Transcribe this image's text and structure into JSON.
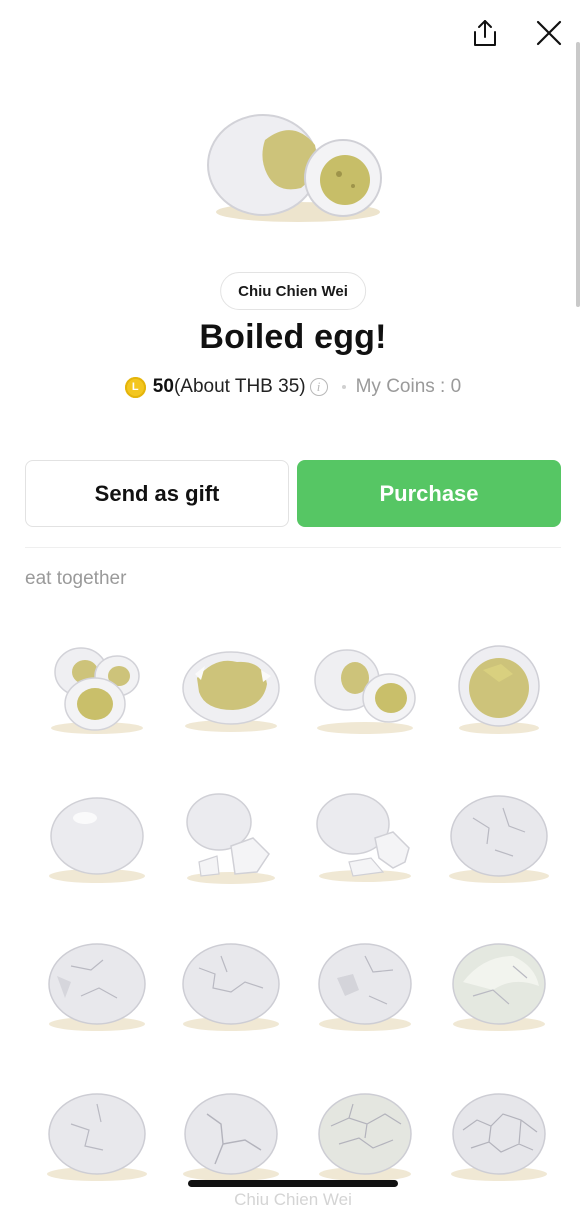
{
  "header": {
    "share_icon": "share-icon",
    "close_icon": "close-icon"
  },
  "sticker": {
    "creator": "Chiu Chien Wei",
    "title": "Boiled egg!"
  },
  "price": {
    "coin_icon": "line-coin-icon",
    "coin_letter": "L",
    "amount": "50",
    "approx": "(About THB 35)",
    "info_icon": "info-icon",
    "my_coins": "My Coins : 0"
  },
  "actions": {
    "gift_label": "Send as gift",
    "purchase_label": "Purchase"
  },
  "colors": {
    "accent": "#56c664",
    "coin": "#f3c61f",
    "muted": "#9a9a9a"
  },
  "section": {
    "label": "eat together",
    "more_text": "Chiu Chien Wei"
  },
  "stickers": [
    {
      "name": "two-halved-eggs"
    },
    {
      "name": "crumbled-yolk-egg"
    },
    {
      "name": "halved-egg-with-whole"
    },
    {
      "name": "split-egg-open"
    },
    {
      "name": "whole-egg"
    },
    {
      "name": "egg-with-shell-pieces"
    },
    {
      "name": "egg-with-shell-pile"
    },
    {
      "name": "cracked-egg"
    },
    {
      "name": "cracked-egg-dent"
    },
    {
      "name": "cracked-egg-lines"
    },
    {
      "name": "cracked-egg-broken"
    },
    {
      "name": "half-peeled-egg"
    },
    {
      "name": "cracked-egg-large"
    },
    {
      "name": "cracked-egg-split"
    },
    {
      "name": "cracked-egg-mosaic"
    },
    {
      "name": "shattered-shell-egg"
    }
  ]
}
